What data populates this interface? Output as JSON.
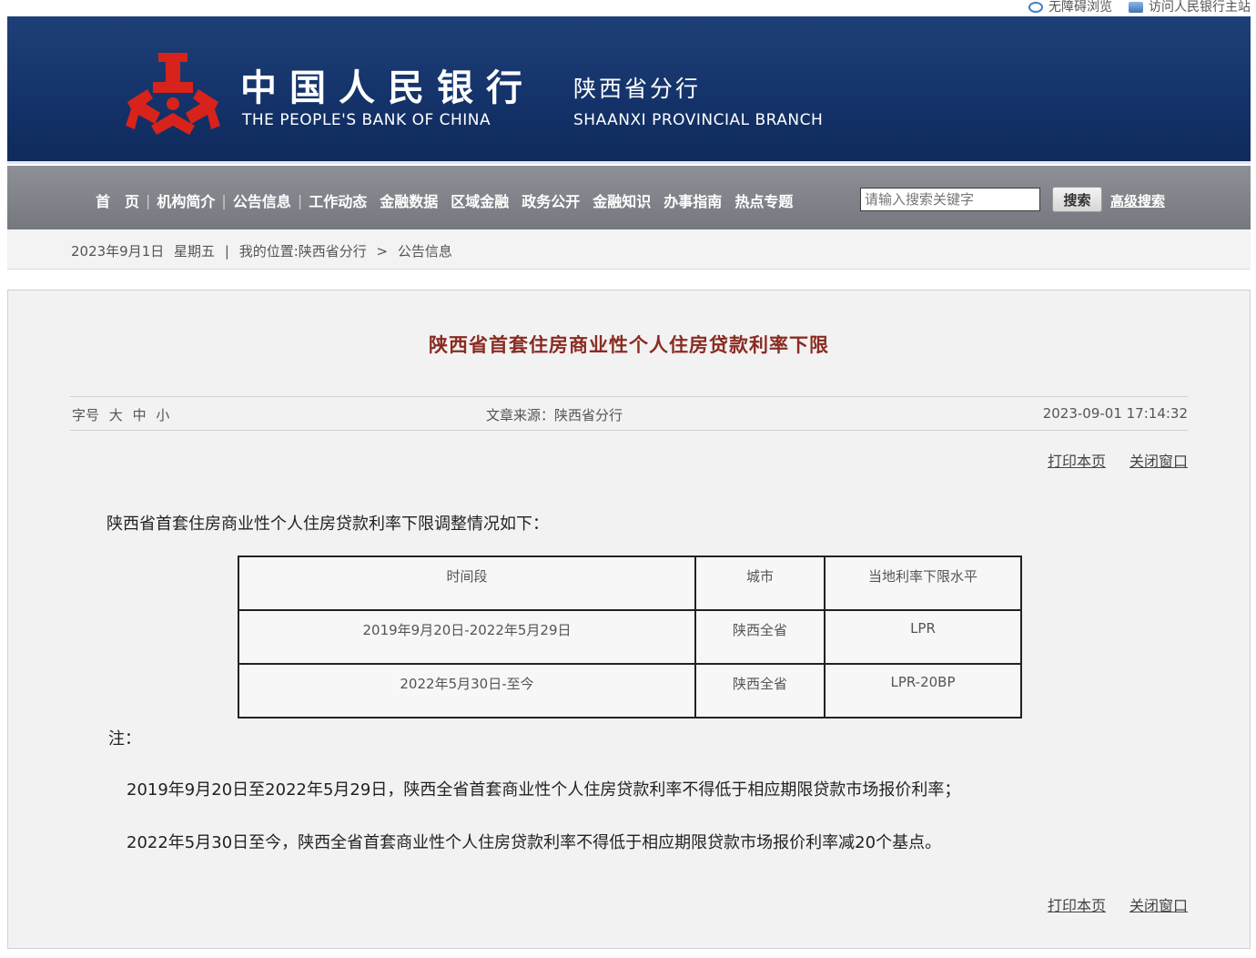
{
  "toplinks": {
    "accessibility": "无障碍浏览",
    "main_site": "访问人民银行主站",
    "accessibility_icon": "ie-icon",
    "main_site_icon": "site-icon"
  },
  "header": {
    "bank_cn": "中国人民银行",
    "branch_cn": "陕西省分行",
    "bank_en": "THE PEOPLE'S BANK OF CHINA",
    "branch_en": "SHAANXI PROVINCIAL BRANCH",
    "logo_color": "#d7231b"
  },
  "nav": {
    "items": [
      "首　页",
      "机构简介",
      "公告信息",
      "工作动态",
      "金融数据",
      "区域金融",
      "政务公开",
      "金融知识",
      "办事指南",
      "热点专题"
    ],
    "search_placeholder": "请输入搜索关键字",
    "search_button": "搜索",
    "advanced_search": "高级搜索"
  },
  "breadcrumb": {
    "date": "2023年9月1日",
    "weekday": "星期五",
    "separator": "|",
    "location_label": "我的位置:陕西省分行",
    "arrow": ">",
    "current": "公告信息"
  },
  "article": {
    "title": "陕西省首套住房商业性个人住房贷款利率下限",
    "font_size_label": "字号",
    "font_large": "大",
    "font_medium": "中",
    "font_small": "小",
    "source": "文章来源：陕西省分行",
    "datetime": "2023-09-01 17:14:32",
    "print": "打印本页",
    "close": "关闭窗口",
    "intro": "陕西省首套住房商业性个人住房贷款利率下限调整情况如下：",
    "table": {
      "headers": [
        "时间段",
        "城市",
        "当地利率下限水平"
      ],
      "rows": [
        [
          "2019年9月20日-2022年5月29日",
          "陕西全省",
          "LPR"
        ],
        [
          "2022年5月30日-至今",
          "陕西全省",
          "LPR-20BP"
        ]
      ]
    },
    "note_label": "注：",
    "notes": [
      "2019年9月20日至2022年5月29日，陕西全省首套商业性个人住房贷款利率不得低于相应期限贷款市场报价利率；",
      "2022年5月30日至今，陕西全省首套商业性个人住房贷款利率不得低于相应期限贷款市场报价利率减20个基点。"
    ]
  }
}
